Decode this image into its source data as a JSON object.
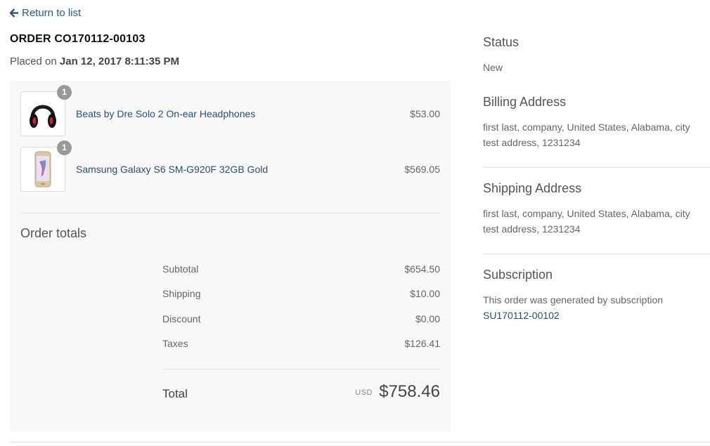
{
  "nav": {
    "back_label": "Return to list"
  },
  "order": {
    "title": "ORDER CO170112-00103",
    "placed_prefix": "Placed on",
    "placed_date": "Jan 12, 2017 8:11:35 PM"
  },
  "items": [
    {
      "name": "Beats by Dre Solo 2 On-ear Headphones",
      "price": "$53.00",
      "qty": "1",
      "icon": "headphones-icon"
    },
    {
      "name": "Samsung Galaxy S6 SM-G920F 32GB Gold",
      "price": "$569.05",
      "qty": "1",
      "icon": "smartphone-icon"
    }
  ],
  "totals": {
    "title": "Order totals",
    "rows": [
      {
        "label": "Subtotal",
        "value": "$654.50"
      },
      {
        "label": "Shipping",
        "value": "$10.00"
      },
      {
        "label": "Discount",
        "value": "$0.00"
      },
      {
        "label": "Taxes",
        "value": "$126.41"
      }
    ],
    "grand_label": "Total",
    "currency": "USD",
    "grand_value": "$758.46"
  },
  "sidebar": {
    "status": {
      "heading": "Status",
      "value": "New"
    },
    "billing": {
      "heading": "Billing Address",
      "line1": "first last, company, United States, Alabama, city",
      "line2": "test address, 1231234"
    },
    "shipping": {
      "heading": "Shipping Address",
      "line1": "first last, company, United States, Alabama, city",
      "line2": "test address, 1231234"
    },
    "subscription": {
      "heading": "Subscription",
      "text": "This order was generated by subscription",
      "link": "SU170112-00102"
    }
  },
  "colors": {
    "link": "#2a4f7a",
    "panel_bg": "#f8f8f8",
    "badge": "#999999"
  }
}
